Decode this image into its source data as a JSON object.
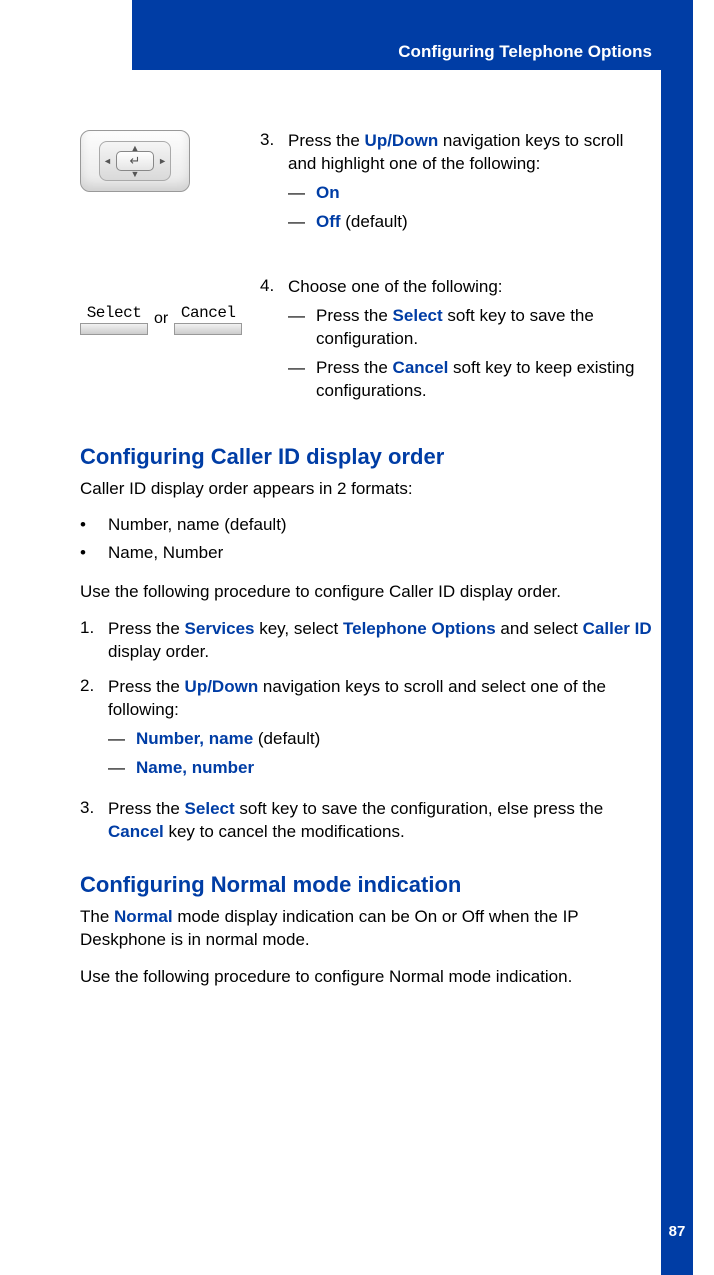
{
  "header": {
    "title": "Configuring Telephone Options"
  },
  "page_number": "87",
  "step3": {
    "num": "3.",
    "text_a": "Press the ",
    "key": "Up/Down",
    "text_b": " navigation keys to scroll and highlight one of the following:",
    "opt1_dash": "—",
    "opt1": "On",
    "opt2_dash": "—",
    "opt2": "Off",
    "opt2_suffix": " (default)"
  },
  "softkeys": {
    "select": "Select",
    "cancel": "Cancel",
    "or": "or"
  },
  "step4": {
    "num": "4.",
    "text": "Choose one of the following:",
    "s1_dash": "—",
    "s1_a": "Press the ",
    "s1_key": "Select",
    "s1_b": " soft key to save the configuration.",
    "s2_dash": "—",
    "s2_a": "Press the ",
    "s2_key": "Cancel",
    "s2_b": " soft key to keep existing configurations."
  },
  "sec1": {
    "heading": "Configuring Caller ID display order",
    "intro": "Caller ID display order appears in 2 formats:",
    "b1": "Number, name (default)",
    "b2": "Name, Number",
    "proc_intro": "Use the following procedure to configure Caller ID display order.",
    "p1": {
      "num": "1.",
      "a": "Press the ",
      "k1": "Services",
      "b": " key, select ",
      "k2": "Telephone Options",
      "c": " and select ",
      "k3": "Caller ID",
      "d": " display order."
    },
    "p2": {
      "num": "2.",
      "a": "Press the ",
      "k1": "Up/Down",
      "b": " navigation keys to scroll and select one of the following:",
      "o1_dash": "—",
      "o1": "Number, name",
      "o1_suffix": " (default)",
      "o2_dash": "—",
      "o2": "Name, number"
    },
    "p3": {
      "num": "3.",
      "a": "Press the ",
      "k1": "Select",
      "b": " soft key to save the configuration, else press the ",
      "k2": "Cancel",
      "c": " key to cancel the modifications."
    }
  },
  "sec2": {
    "heading": "Configuring Normal mode indication",
    "intro_a": "The ",
    "intro_key": "Normal",
    "intro_b": " mode display indication can be On or Off when the IP Deskphone is in normal mode.",
    "proc_intro": "Use the following procedure to configure Normal mode indication."
  }
}
